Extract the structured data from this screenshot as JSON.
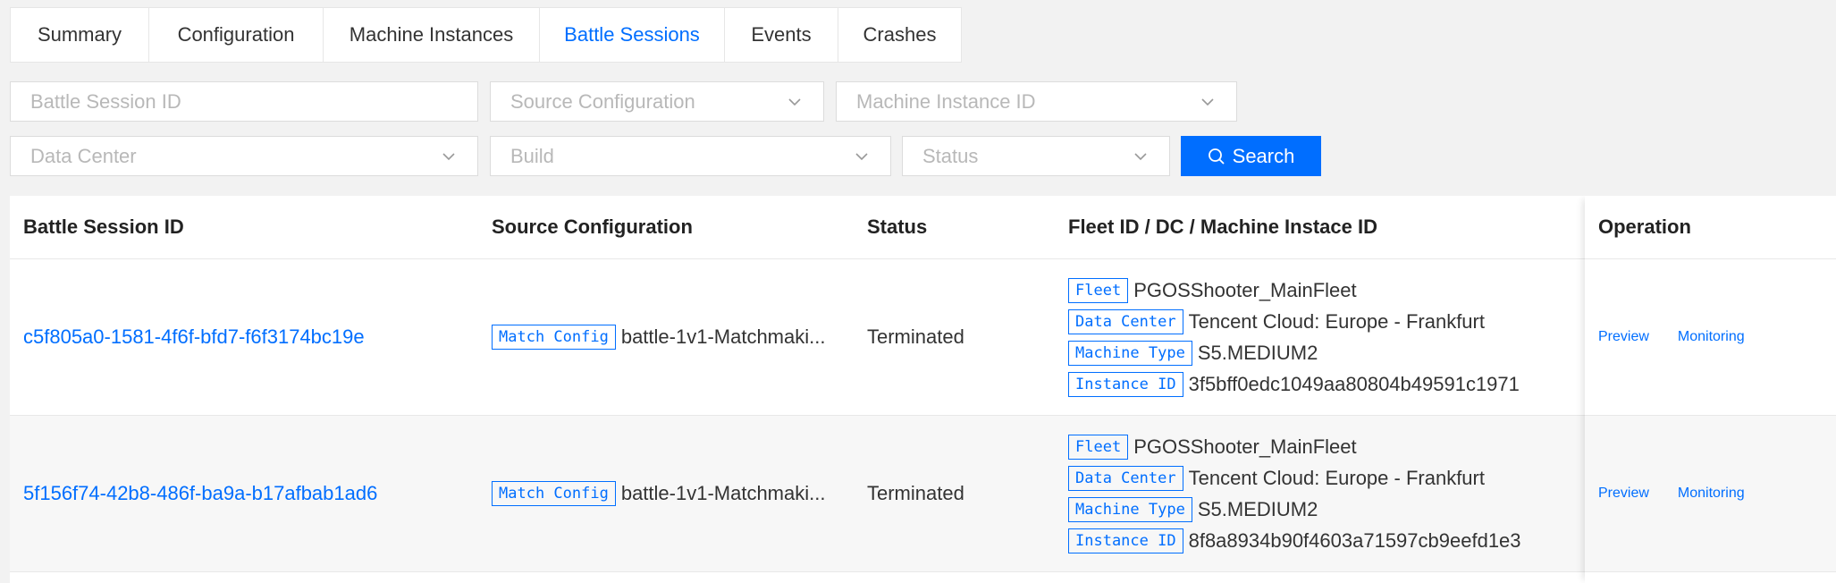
{
  "tabs": [
    {
      "label": "Summary"
    },
    {
      "label": "Configuration"
    },
    {
      "label": "Machine Instances"
    },
    {
      "label": "Battle Sessions",
      "active": true
    },
    {
      "label": "Events"
    },
    {
      "label": "Crashes"
    }
  ],
  "filters": {
    "battle_session_id": "Battle Session ID",
    "source_configuration": "Source Configuration",
    "machine_instance_id": "Machine Instance ID",
    "data_center": "Data Center",
    "build": "Build",
    "status": "Status",
    "search_label": "Search"
  },
  "table": {
    "columns": {
      "battle_session_id": "Battle Session ID",
      "source_configuration": "Source Configuration",
      "status": "Status",
      "fleet": "Fleet ID / DC / Machine Instace ID",
      "operation": "Operation"
    },
    "tags": {
      "match_config": "Match Config",
      "fleet": "Fleet",
      "data_center": "Data Center",
      "machine_type": "Machine Type",
      "instance_id": "Instance ID"
    },
    "rows": [
      {
        "id": "c5f805a0-1581-4f6f-bfd7-f6f3174bc19e",
        "source": "battle-1v1-Matchmaki...",
        "status": "Terminated",
        "fleet": "PGOSShooter_MainFleet",
        "data_center": "Tencent Cloud: Europe - Frankfurt",
        "machine_type": "S5.MEDIUM2",
        "instance_id": "3f5bff0edc1049aa80804b49591c1971",
        "preview": "Preview",
        "monitoring": "Monitoring"
      },
      {
        "id": "5f156f74-42b8-486f-ba9a-b17afbab1ad6",
        "source": "battle-1v1-Matchmaki...",
        "status": "Terminated",
        "fleet": "PGOSShooter_MainFleet",
        "data_center": "Tencent Cloud: Europe - Frankfurt",
        "machine_type": "S5.MEDIUM2",
        "instance_id": "8f8a8934b90f4603a71597cb9eefd1e3",
        "preview": "Preview",
        "monitoring": "Monitoring"
      }
    ]
  },
  "colors": {
    "accent": "#006eff",
    "background": "#f2f2f2",
    "placeholder": "#b8b8b8"
  }
}
